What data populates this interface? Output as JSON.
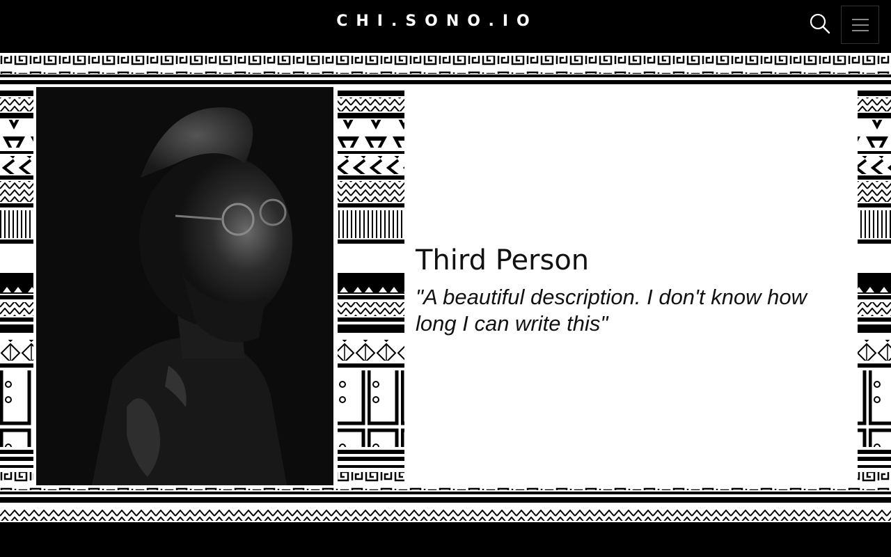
{
  "header": {
    "brand": "CHI.SONO.IO",
    "search_icon": "search-icon",
    "menu_icon": "hamburger-menu-icon"
  },
  "profile": {
    "name": "Third Person",
    "quote": "\"A beautiful description. I don't know how long I can write this\""
  },
  "colors": {
    "background": "#000000",
    "pattern_light": "#ffffff",
    "pattern_dark": "#000000",
    "card": "#ffffff"
  }
}
